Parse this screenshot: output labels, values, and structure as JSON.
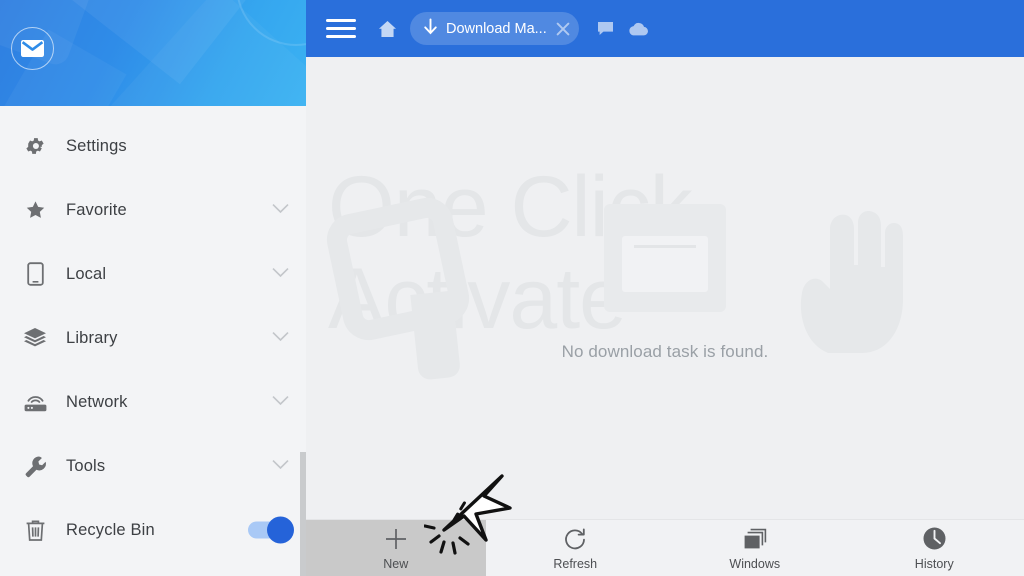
{
  "sidebar": {
    "header": {
      "avatar_icon": "mail-envelope-icon"
    },
    "items": [
      {
        "label": "Settings",
        "icon": "gear-icon",
        "chevron": false,
        "toggle": false
      },
      {
        "label": "Favorite",
        "icon": "star-icon",
        "chevron": true,
        "toggle": false
      },
      {
        "label": "Local",
        "icon": "phone-icon",
        "chevron": true,
        "toggle": false
      },
      {
        "label": "Library",
        "icon": "layers-icon",
        "chevron": true,
        "toggle": false
      },
      {
        "label": "Network",
        "icon": "router-icon",
        "chevron": true,
        "toggle": false
      },
      {
        "label": "Tools",
        "icon": "wrench-icon",
        "chevron": true,
        "toggle": false
      },
      {
        "label": "Recycle Bin",
        "icon": "trash-icon",
        "chevron": false,
        "toggle": true,
        "toggle_on": true
      }
    ]
  },
  "topbar": {
    "menu_icon": "hamburger-menu-icon",
    "home_icon": "home-icon",
    "tab": {
      "title": "Download Ma...",
      "icon": "download-arrow-icon",
      "close_icon": "close-x-icon"
    },
    "chat_icon": "chat-bubble-icon",
    "cloud_icon": "cloud-icon",
    "accent_color": "#2a6fdb"
  },
  "main": {
    "empty_message": "No download task is found.",
    "empty_icon": "empty-folder-icon",
    "watermark_text": "One Click\nActivate",
    "watermark_logo": "one-click-activate-logo",
    "watermark_hand": "pointing-hand-icon"
  },
  "bottombar": {
    "items": [
      {
        "label": "New",
        "icon": "plus-icon",
        "active": true
      },
      {
        "label": "Refresh",
        "icon": "refresh-icon",
        "active": false
      },
      {
        "label": "Windows",
        "icon": "windows-stack-icon",
        "active": false
      },
      {
        "label": "History",
        "icon": "clock-icon",
        "active": false
      }
    ]
  },
  "annotation": {
    "cursor": "click-cursor-arrow",
    "target": "New"
  },
  "colors": {
    "primary_blue": "#2a6fdb",
    "header_gradient_start": "#2f7ee0",
    "header_gradient_end": "#3bb2f2",
    "toggle_on": "#2563d9",
    "sidebar_bg": "#f3f4f6",
    "content_bg": "#eff0f2",
    "active_item_bg": "#c9c9c9"
  }
}
